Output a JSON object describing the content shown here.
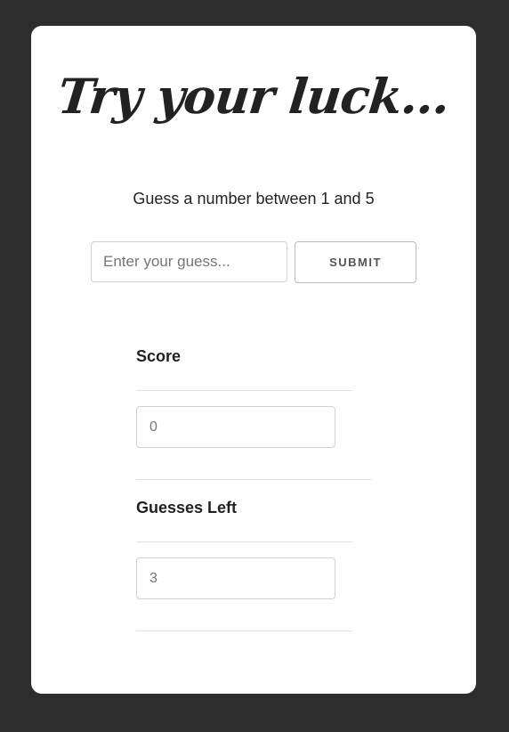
{
  "header": {
    "title": "Try your luck..."
  },
  "game": {
    "prompt": "Guess a number between 1 and 5",
    "guess_placeholder": "Enter your guess...",
    "submit_label": "SUBMIT"
  },
  "stats": {
    "score_label": "Score",
    "score_value": "0",
    "guesses_left_label": "Guesses Left",
    "guesses_left_value": "3"
  },
  "colors": {
    "background": "#2d2d2d",
    "card": "#ffffff",
    "text": "#222222"
  }
}
